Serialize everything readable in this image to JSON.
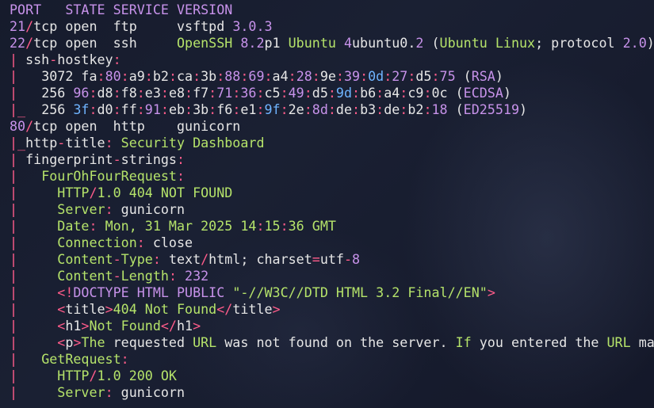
{
  "theme": {
    "background": "#121626",
    "colors": {
      "purple": "#c792ea",
      "green": "#b5e36a",
      "white": "#e6e6e6",
      "pink": "#ff5c8a",
      "blue": "#6fb4ff"
    }
  },
  "lines": [
    [
      [
        "PORT   STATE SERVICE VERSION",
        "purple"
      ]
    ],
    [
      [
        "21",
        "purple"
      ],
      [
        "/",
        "pink"
      ],
      [
        "tcp open  ftp     vsftpd ",
        "white"
      ],
      [
        "3.0.3",
        "purple"
      ]
    ],
    [
      [
        "22",
        "purple"
      ],
      [
        "/",
        "pink"
      ],
      [
        "tcp open  ssh     ",
        "white"
      ],
      [
        "OpenSSH ",
        "green"
      ],
      [
        "8.2",
        "purple"
      ],
      [
        "p1 ",
        "white"
      ],
      [
        "Ubuntu ",
        "green"
      ],
      [
        "4",
        "purple"
      ],
      [
        "ubuntu0.",
        "white"
      ],
      [
        "2",
        "purple"
      ],
      [
        " (",
        "white"
      ],
      [
        "Ubuntu Linux",
        "green"
      ],
      [
        "; protocol ",
        "white"
      ],
      [
        "2.0",
        "purple"
      ],
      [
        ")",
        "white"
      ]
    ],
    [
      [
        "| ",
        "pink"
      ],
      [
        "ssh",
        "white"
      ],
      [
        "-",
        "pink"
      ],
      [
        "hostkey",
        "white"
      ],
      [
        ":",
        "pink"
      ]
    ],
    [
      [
        "|   ",
        "pink"
      ],
      [
        "3072 ",
        "white"
      ],
      [
        "fa",
        "white"
      ],
      [
        ":",
        "pink"
      ],
      [
        "80",
        "purple"
      ],
      [
        ":",
        "pink"
      ],
      [
        "a9",
        "white"
      ],
      [
        ":",
        "pink"
      ],
      [
        "b2",
        "white"
      ],
      [
        ":",
        "pink"
      ],
      [
        "ca",
        "white"
      ],
      [
        ":",
        "pink"
      ],
      [
        "3b",
        "white"
      ],
      [
        ":",
        "pink"
      ],
      [
        "88",
        "purple"
      ],
      [
        ":",
        "pink"
      ],
      [
        "69",
        "purple"
      ],
      [
        ":",
        "pink"
      ],
      [
        "a4",
        "white"
      ],
      [
        ":",
        "pink"
      ],
      [
        "28",
        "purple"
      ],
      [
        ":",
        "pink"
      ],
      [
        "9e",
        "white"
      ],
      [
        ":",
        "pink"
      ],
      [
        "39",
        "purple"
      ],
      [
        ":",
        "pink"
      ],
      [
        "0d",
        "blue"
      ],
      [
        ":",
        "pink"
      ],
      [
        "27",
        "purple"
      ],
      [
        ":",
        "pink"
      ],
      [
        "d5",
        "white"
      ],
      [
        ":",
        "pink"
      ],
      [
        "75",
        "purple"
      ],
      [
        " (",
        "white"
      ],
      [
        "RSA",
        "purple"
      ],
      [
        ")",
        "white"
      ]
    ],
    [
      [
        "|   ",
        "pink"
      ],
      [
        "256 ",
        "white"
      ],
      [
        "96",
        "purple"
      ],
      [
        ":",
        "pink"
      ],
      [
        "d8",
        "white"
      ],
      [
        ":",
        "pink"
      ],
      [
        "f8",
        "white"
      ],
      [
        ":",
        "pink"
      ],
      [
        "e3",
        "white"
      ],
      [
        ":",
        "pink"
      ],
      [
        "e8",
        "white"
      ],
      [
        ":",
        "pink"
      ],
      [
        "f7",
        "white"
      ],
      [
        ":",
        "pink"
      ],
      [
        "71",
        "purple"
      ],
      [
        ":",
        "pink"
      ],
      [
        "36",
        "purple"
      ],
      [
        ":",
        "pink"
      ],
      [
        "c5",
        "white"
      ],
      [
        ":",
        "pink"
      ],
      [
        "49",
        "purple"
      ],
      [
        ":",
        "pink"
      ],
      [
        "d5",
        "white"
      ],
      [
        ":",
        "pink"
      ],
      [
        "9d",
        "blue"
      ],
      [
        ":",
        "pink"
      ],
      [
        "b6",
        "white"
      ],
      [
        ":",
        "pink"
      ],
      [
        "a4",
        "white"
      ],
      [
        ":",
        "pink"
      ],
      [
        "c9",
        "white"
      ],
      [
        ":",
        "pink"
      ],
      [
        "0c",
        "white"
      ],
      [
        " (",
        "white"
      ],
      [
        "ECDSA",
        "purple"
      ],
      [
        ")",
        "white"
      ]
    ],
    [
      [
        "|_  ",
        "pink"
      ],
      [
        "256 ",
        "white"
      ],
      [
        "3f",
        "blue"
      ],
      [
        ":",
        "pink"
      ],
      [
        "d0",
        "white"
      ],
      [
        ":",
        "pink"
      ],
      [
        "ff",
        "white"
      ],
      [
        ":",
        "pink"
      ],
      [
        "91",
        "purple"
      ],
      [
        ":",
        "pink"
      ],
      [
        "eb",
        "white"
      ],
      [
        ":",
        "pink"
      ],
      [
        "3b",
        "white"
      ],
      [
        ":",
        "pink"
      ],
      [
        "f6",
        "white"
      ],
      [
        ":",
        "pink"
      ],
      [
        "e1",
        "white"
      ],
      [
        ":",
        "pink"
      ],
      [
        "9f",
        "blue"
      ],
      [
        ":",
        "pink"
      ],
      [
        "2e",
        "white"
      ],
      [
        ":",
        "pink"
      ],
      [
        "8d",
        "purple"
      ],
      [
        ":",
        "pink"
      ],
      [
        "de",
        "white"
      ],
      [
        ":",
        "pink"
      ],
      [
        "b3",
        "white"
      ],
      [
        ":",
        "pink"
      ],
      [
        "de",
        "white"
      ],
      [
        ":",
        "pink"
      ],
      [
        "b2",
        "white"
      ],
      [
        ":",
        "pink"
      ],
      [
        "18",
        "purple"
      ],
      [
        " (",
        "white"
      ],
      [
        "ED25519",
        "purple"
      ],
      [
        ")",
        "white"
      ]
    ],
    [
      [
        "80",
        "purple"
      ],
      [
        "/",
        "pink"
      ],
      [
        "tcp open  http    gunicorn",
        "white"
      ]
    ],
    [
      [
        "|_",
        "pink"
      ],
      [
        "http",
        "white"
      ],
      [
        "-",
        "pink"
      ],
      [
        "title",
        "white"
      ],
      [
        ": ",
        "pink"
      ],
      [
        "Security Dashboard",
        "green"
      ]
    ],
    [
      [
        "| ",
        "pink"
      ],
      [
        "fingerprint",
        "white"
      ],
      [
        "-",
        "pink"
      ],
      [
        "strings",
        "white"
      ],
      [
        ":",
        "pink"
      ]
    ],
    [
      [
        "|   ",
        "pink"
      ],
      [
        "FourOhFourRequest",
        "green"
      ],
      [
        ":",
        "pink"
      ]
    ],
    [
      [
        "|     ",
        "pink"
      ],
      [
        "HTTP",
        "green"
      ],
      [
        "/",
        "pink"
      ],
      [
        "1.0 404 NOT FOUND",
        "green"
      ]
    ],
    [
      [
        "|     ",
        "pink"
      ],
      [
        "Server",
        "green"
      ],
      [
        ": ",
        "pink"
      ],
      [
        "gunicorn",
        "white"
      ]
    ],
    [
      [
        "|     ",
        "pink"
      ],
      [
        "Date",
        "green"
      ],
      [
        ": ",
        "pink"
      ],
      [
        "Mon, 31 Mar 2025 14",
        "green"
      ],
      [
        ":",
        "pink"
      ],
      [
        "15",
        "green"
      ],
      [
        ":",
        "pink"
      ],
      [
        "36 GMT",
        "green"
      ]
    ],
    [
      [
        "|     ",
        "pink"
      ],
      [
        "Connection",
        "green"
      ],
      [
        ": ",
        "pink"
      ],
      [
        "close",
        "white"
      ]
    ],
    [
      [
        "|     ",
        "pink"
      ],
      [
        "Content",
        "green"
      ],
      [
        "-",
        "pink"
      ],
      [
        "Type",
        "green"
      ],
      [
        ": ",
        "pink"
      ],
      [
        "text",
        "white"
      ],
      [
        "/",
        "pink"
      ],
      [
        "html; charset",
        "white"
      ],
      [
        "=",
        "pink"
      ],
      [
        "utf",
        "white"
      ],
      [
        "-",
        "pink"
      ],
      [
        "8",
        "purple"
      ]
    ],
    [
      [
        "|     ",
        "pink"
      ],
      [
        "Content",
        "green"
      ],
      [
        "-",
        "pink"
      ],
      [
        "Length",
        "green"
      ],
      [
        ": ",
        "pink"
      ],
      [
        "232",
        "purple"
      ]
    ],
    [
      [
        "|     ",
        "pink"
      ],
      [
        "<!",
        "pink"
      ],
      [
        "DOCTYPE HTML PUBLIC ",
        "purple"
      ],
      [
        "\"-//W3C//DTD HTML 3.2 Final//EN\"",
        "green"
      ],
      [
        ">",
        "pink"
      ]
    ],
    [
      [
        "|     ",
        "pink"
      ],
      [
        "<",
        "pink"
      ],
      [
        "title",
        "white"
      ],
      [
        ">",
        "pink"
      ],
      [
        "404 Not Found",
        "green"
      ],
      [
        "</",
        "pink"
      ],
      [
        "title",
        "white"
      ],
      [
        ">",
        "pink"
      ]
    ],
    [
      [
        "|     ",
        "pink"
      ],
      [
        "<",
        "pink"
      ],
      [
        "h1",
        "white"
      ],
      [
        ">",
        "pink"
      ],
      [
        "Not Found",
        "green"
      ],
      [
        "</",
        "pink"
      ],
      [
        "h1",
        "white"
      ],
      [
        ">",
        "pink"
      ]
    ],
    [
      [
        "|     ",
        "pink"
      ],
      [
        "<",
        "pink"
      ],
      [
        "p",
        "white"
      ],
      [
        ">",
        "pink"
      ],
      [
        "The ",
        "green"
      ],
      [
        "requested ",
        "white"
      ],
      [
        "URL ",
        "green"
      ],
      [
        "was not found on the server. ",
        "white"
      ],
      [
        "If ",
        "green"
      ],
      [
        "you entered the ",
        "white"
      ],
      [
        "URL ",
        "green"
      ],
      [
        "manually please check your spelling and try again.",
        "white"
      ]
    ],
    [
      [
        "|   ",
        "pink"
      ],
      [
        "GetRequest",
        "green"
      ],
      [
        ":",
        "pink"
      ]
    ],
    [
      [
        "|     ",
        "pink"
      ],
      [
        "HTTP",
        "green"
      ],
      [
        "/",
        "pink"
      ],
      [
        "1.0 200 OK",
        "green"
      ]
    ],
    [
      [
        "|     ",
        "pink"
      ],
      [
        "Server",
        "green"
      ],
      [
        ": ",
        "pink"
      ],
      [
        "gunicorn",
        "white"
      ]
    ]
  ]
}
